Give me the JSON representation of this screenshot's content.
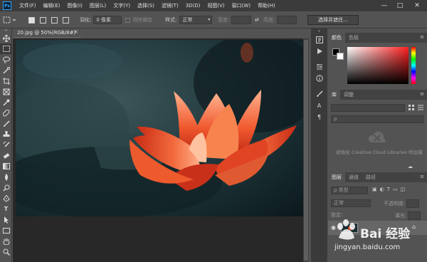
{
  "app": {
    "logo": "Ps"
  },
  "menubar": {
    "items": [
      "文件(F)",
      "编辑(E)",
      "图像(I)",
      "图层(L)",
      "文字(Y)",
      "选择(S)",
      "滤镜(T)",
      "3D(D)",
      "视图(V)",
      "窗口(W)",
      "帮助(H)"
    ],
    "controls": {
      "minimize": "—",
      "maximize": "□",
      "close": "✕"
    }
  },
  "options": {
    "feather_label": "羽化:",
    "feather_value": "0 像素",
    "antialias_label": "消除锯齿",
    "style_label": "样式:",
    "style_value": "正常",
    "width_label": "宽度:",
    "height_label": "高度:",
    "select_mask_label": "选择并遮住...",
    "swap_icon": "⇄"
  },
  "document": {
    "tab_title": "20.jpg @ 50%(RGB/8#)",
    "close": "×"
  },
  "panels": {
    "color": {
      "tabs": [
        "颜色",
        "色板"
      ],
      "active": 0
    },
    "library": {
      "tabs": [
        "库",
        "调整"
      ],
      "active": 0,
      "search_placeholder": "",
      "message": "初始化 Creative Cloud Libraries 时出错"
    },
    "layers": {
      "tabs": [
        "图层",
        "通道",
        "路径"
      ],
      "active": 0,
      "filter_label": "ρ 类型",
      "blend_mode": "正常",
      "opacity_label": "不透明度:",
      "lock_label": "锁定:",
      "fill_label": "填充:",
      "lock_icon": "🔒"
    }
  },
  "watermark": {
    "brand": "Bai 经验",
    "url": "jingyan.baidu.com"
  },
  "colors": {
    "menubar_bg": "#3b3b3b",
    "panel_bg": "#535353",
    "canvas_bg": "#282828",
    "accent": "#31a8ff",
    "flower_red": "#e3421f"
  },
  "icons": {
    "tools": [
      "move-icon",
      "marquee-icon",
      "lasso-icon",
      "quick-select-icon",
      "crop-icon",
      "frame-icon",
      "eyedropper-icon",
      "healing-icon",
      "brush-icon",
      "stamp-icon",
      "history-brush-icon",
      "eraser-icon",
      "gradient-icon",
      "blur-icon",
      "dodge-icon",
      "pen-icon",
      "type-icon",
      "path-select-icon",
      "shape-icon",
      "hand-icon",
      "zoom-icon"
    ]
  }
}
